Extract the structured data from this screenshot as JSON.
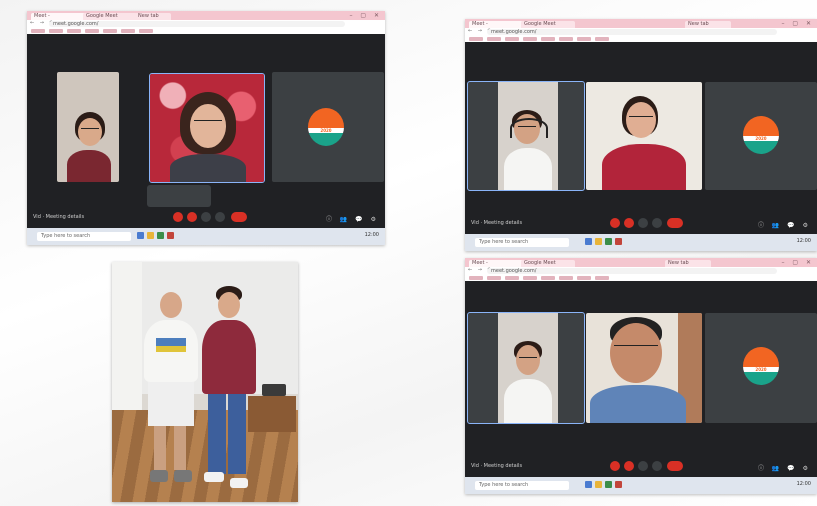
{
  "shots": [
    {
      "id": "top-left",
      "tabs": [
        "Meet - ",
        "Google Meet",
        "New tab"
      ],
      "url": "meet.google.com/",
      "meeting_info": "Vid  · Meeting details",
      "tooltip": "",
      "participants": [
        "",
        "",
        ""
      ],
      "clock": "12:00"
    },
    {
      "id": "top-right",
      "tabs": [
        "Meet - ",
        "Google Meet",
        "New tab"
      ],
      "url": "meet.google.com/",
      "meeting_info": "Vid  · Meeting details",
      "participants": [
        "",
        ""
      ],
      "clock": "12:00"
    },
    {
      "id": "bottom-right",
      "tabs": [
        "Meet - ",
        "Google Meet",
        "New tab"
      ],
      "url": "meet.google.com/",
      "meeting_info": "Vid  · Meeting details",
      "participants": [
        "",
        ""
      ],
      "clock": "12:00"
    }
  ],
  "search_placeholder": "Type here to search",
  "logo_label": "2020",
  "colors": {
    "logo_orange": "#f26522",
    "logo_teal": "#1aa38a",
    "meet_bg": "#202124",
    "hangup_red": "#d93025"
  }
}
